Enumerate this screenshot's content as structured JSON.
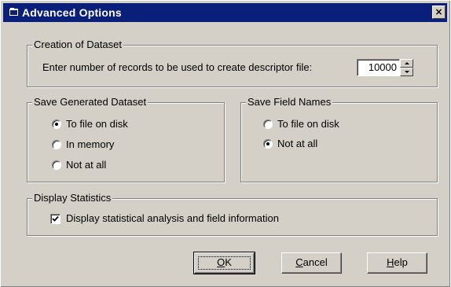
{
  "window": {
    "title": "Advanced Options",
    "close_glyph": "×",
    "title_icon": "dialog-icon"
  },
  "creation_group": {
    "label": "Creation of Dataset",
    "prompt": "Enter number of records to be used to create descriptor file:",
    "records_value": "10000"
  },
  "save_dataset_group": {
    "label": "Save Generated Dataset",
    "options": [
      {
        "label": "To file on disk",
        "checked": true
      },
      {
        "label": "In memory",
        "checked": false
      },
      {
        "label": "Not at all",
        "checked": false
      }
    ]
  },
  "save_field_names_group": {
    "label": "Save Field Names",
    "options": [
      {
        "label": "To file on disk",
        "checked": false
      },
      {
        "label": "Not at all",
        "checked": true
      }
    ]
  },
  "display_stats_group": {
    "label": "Display Statistics",
    "checkbox_label": "Display statistical analysis and field information",
    "checked": true
  },
  "buttons": {
    "ok": {
      "mnemonic": "O",
      "rest": "K"
    },
    "cancel": {
      "mnemonic": "C",
      "rest": "ancel"
    },
    "help": {
      "mnemonic": "H",
      "rest": "elp"
    }
  }
}
